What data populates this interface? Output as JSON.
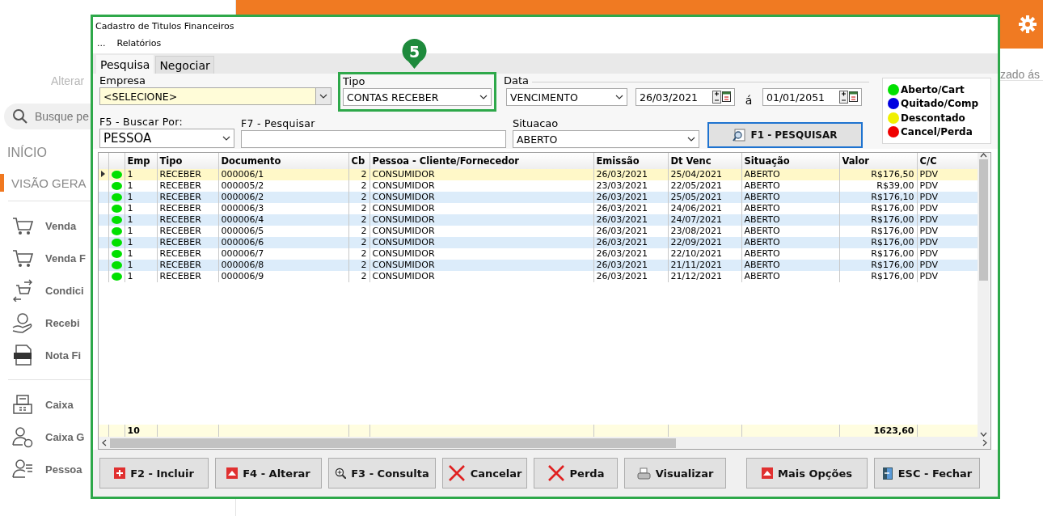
{
  "background_app": {
    "side_note": "zado ás",
    "sidebar": {
      "subtitle": "Alterar",
      "search": {
        "placeholder": "Busque pe"
      },
      "section": "INÍCIO",
      "active_item": "VISÃO GERA",
      "groups": [
        {
          "items": [
            "Venda",
            "Venda F",
            "Condici",
            "Recebi",
            "Nota Fi"
          ]
        },
        {
          "items": [
            "Caixa",
            "Caixa G",
            "Pessoa"
          ]
        }
      ]
    }
  },
  "tutorial": {
    "step": "5"
  },
  "window": {
    "title": "Cadastro de Titulos Financeiros",
    "menu": [
      "...",
      "Relatórios"
    ],
    "tabs": [
      {
        "label": "Pesquisa",
        "selected": true
      },
      {
        "label": "Negociar",
        "selected": false
      }
    ],
    "filters": {
      "empresa": {
        "label": "Empresa",
        "value": "<SELECIONE>"
      },
      "tipo": {
        "label": "Tipo",
        "value": "CONTAS RECEBER",
        "highlighted": true
      },
      "data": {
        "label": "Data",
        "field": "VENCIMENTO",
        "from": "26/03/2021",
        "separator": "á",
        "to": "01/01/2051"
      },
      "buscar_por": {
        "label": "F5 - Buscar Por:",
        "value": "PESSOA"
      },
      "pesquisar": {
        "label": "F7 - Pesquisar"
      },
      "situacao": {
        "label": "Situacao",
        "value": "ABERTO"
      },
      "search_button": "F1 - PESQUISAR"
    },
    "legend": [
      {
        "label": "Aberto/Cart",
        "color": "#00e000"
      },
      {
        "label": "Quitado/Comp",
        "color": "#0000e0"
      },
      {
        "label": "Descontado",
        "color": "#f0f000"
      },
      {
        "label": "Cancel/Perda",
        "color": "#f00000"
      }
    ],
    "table": {
      "columns": [
        "Emp",
        "Tipo",
        "Documento",
        "Cb",
        "Pessoa - Cliente/Fornecedor",
        "Emissão",
        "Dt Venc",
        "Situação",
        "Valor",
        "C/C"
      ],
      "rows": [
        {
          "selected": true,
          "color": "#00e000",
          "cells": [
            "1",
            "RECEBER",
            "000006/1",
            "2",
            "CONSUMIDOR",
            "26/03/2021",
            "25/04/2021",
            "ABERTO",
            "R$176,50",
            "PDV"
          ]
        },
        {
          "selected": false,
          "color": "#00e000",
          "cells": [
            "1",
            "RECEBER",
            "000005/2",
            "2",
            "CONSUMIDOR",
            "23/03/2021",
            "22/05/2021",
            "ABERTO",
            "R$39,00",
            "PDV"
          ]
        },
        {
          "selected": false,
          "color": "#00e000",
          "cells": [
            "1",
            "RECEBER",
            "000006/2",
            "2",
            "CONSUMIDOR",
            "26/03/2021",
            "25/05/2021",
            "ABERTO",
            "R$176,10",
            "PDV"
          ]
        },
        {
          "selected": false,
          "color": "#00e000",
          "cells": [
            "1",
            "RECEBER",
            "000006/3",
            "2",
            "CONSUMIDOR",
            "26/03/2021",
            "24/06/2021",
            "ABERTO",
            "R$176,00",
            "PDV"
          ]
        },
        {
          "selected": false,
          "color": "#00e000",
          "cells": [
            "1",
            "RECEBER",
            "000006/4",
            "2",
            "CONSUMIDOR",
            "26/03/2021",
            "24/07/2021",
            "ABERTO",
            "R$176,00",
            "PDV"
          ]
        },
        {
          "selected": false,
          "color": "#00e000",
          "cells": [
            "1",
            "RECEBER",
            "000006/5",
            "2",
            "CONSUMIDOR",
            "26/03/2021",
            "23/08/2021",
            "ABERTO",
            "R$176,00",
            "PDV"
          ]
        },
        {
          "selected": false,
          "color": "#00e000",
          "cells": [
            "1",
            "RECEBER",
            "000006/6",
            "2",
            "CONSUMIDOR",
            "26/03/2021",
            "22/09/2021",
            "ABERTO",
            "R$176,00",
            "PDV"
          ]
        },
        {
          "selected": false,
          "color": "#00e000",
          "cells": [
            "1",
            "RECEBER",
            "000006/7",
            "2",
            "CONSUMIDOR",
            "26/03/2021",
            "22/10/2021",
            "ABERTO",
            "R$176,00",
            "PDV"
          ]
        },
        {
          "selected": false,
          "color": "#00e000",
          "cells": [
            "1",
            "RECEBER",
            "000006/8",
            "2",
            "CONSUMIDOR",
            "26/03/2021",
            "21/11/2021",
            "ABERTO",
            "R$176,00",
            "PDV"
          ]
        },
        {
          "selected": false,
          "color": "#00e000",
          "cells": [
            "1",
            "RECEBER",
            "000006/9",
            "2",
            "CONSUMIDOR",
            "26/03/2021",
            "21/12/2021",
            "ABERTO",
            "R$176,00",
            "PDV"
          ]
        }
      ],
      "totals": {
        "count": "10",
        "valor": "1623,60"
      }
    },
    "buttons": [
      "F2 - Incluir",
      "F4 - Alterar",
      "F3 - Consulta",
      "Cancelar",
      "Perda",
      "Visualizar",
      "Mais Opções",
      "ESC - Fechar"
    ]
  }
}
